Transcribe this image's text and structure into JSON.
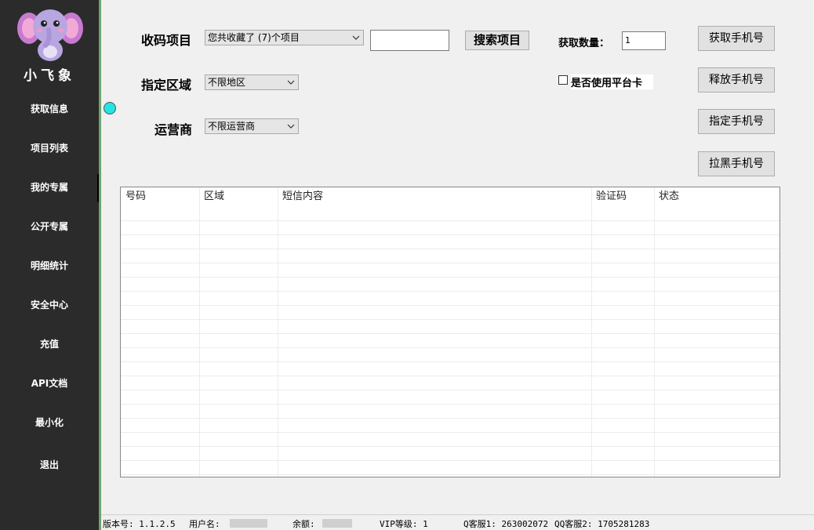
{
  "sidebar": {
    "logo_text": "小飞象",
    "items": [
      {
        "label": "获取信息"
      },
      {
        "label": "项目列表"
      },
      {
        "label": "我的专属"
      },
      {
        "label": "公开专属"
      },
      {
        "label": "明细统计"
      },
      {
        "label": "安全中心"
      },
      {
        "label": "充值"
      },
      {
        "label": "API文档"
      },
      {
        "label": "最小化"
      },
      {
        "label": "退出"
      }
    ]
  },
  "form": {
    "project_label": "收码项目",
    "project_select": "您共收藏了 (7)个项目",
    "search_input_value": "",
    "search_button": "搜索项目",
    "quantity_label": "获取数量：",
    "quantity_value": "1",
    "region_label": "指定区域",
    "region_select": "不限地区",
    "platform_card_label": "是否使用平台卡",
    "operator_label": "运营商",
    "operator_select": "不限运营商"
  },
  "actions": {
    "get_phone": "获取手机号",
    "release_phone": "释放手机号",
    "specify_phone": "指定手机号",
    "blacklist_phone": "拉黑手机号"
  },
  "table": {
    "columns": [
      "号码",
      "区域",
      "短信内容",
      "验证码",
      "状态"
    ],
    "rows": []
  },
  "status_bar": {
    "version": "版本号: 1.1.2.5",
    "username_label": "用户名:",
    "balance_label": "余额:",
    "vip": "VIP等级: 1",
    "qq1": "Q客服1: 263002072",
    "qq2": "QQ客服2: 1705281283"
  },
  "colors": {
    "sidebar_bg": "#2b2b2b",
    "accent_line": "#6fa36f",
    "indicator": "#24e5e5"
  }
}
